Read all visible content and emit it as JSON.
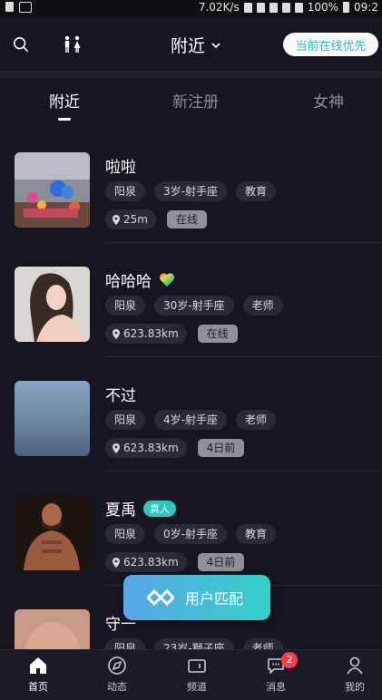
{
  "status_bar": {
    "net_speed": "7.02K/s",
    "battery": "100%",
    "time": "09:2"
  },
  "header": {
    "title": "附近",
    "online_first_label": "当前在线优先"
  },
  "tabs": [
    {
      "label": "附近",
      "active": true
    },
    {
      "label": "新注册",
      "active": false
    },
    {
      "label": "女神",
      "active": false
    }
  ],
  "users": [
    {
      "name": "啦啦",
      "badge": "",
      "tags": [
        "阳泉",
        "3岁-射手座",
        "教育"
      ],
      "distance": "25m",
      "status": "在线"
    },
    {
      "name": "哈哈哈",
      "badge": "",
      "tags": [
        "阳泉",
        "30岁-射手座",
        "老师"
      ],
      "distance": "623.83km",
      "status": "在线"
    },
    {
      "name": "不过",
      "badge": "",
      "tags": [
        "阳泉",
        "4岁-射手座",
        "老师"
      ],
      "distance": "623.83km",
      "status": "4日前"
    },
    {
      "name": "夏禹",
      "badge": "真人",
      "tags": [
        "阳泉",
        "0岁-射手座",
        "教育"
      ],
      "distance": "623.83km",
      "status": "4日前"
    },
    {
      "name": "守一",
      "badge": "",
      "tags": [
        "阳泉",
        "23岁-獅子座",
        "老师"
      ],
      "distance": "",
      "status": ""
    }
  ],
  "match_button": {
    "label": "用户匹配"
  },
  "bottom_nav": [
    {
      "label": "首页",
      "icon": "home-icon",
      "active": true
    },
    {
      "label": "动态",
      "icon": "compass-icon",
      "active": false
    },
    {
      "label": "频道",
      "icon": "video-icon",
      "active": false
    },
    {
      "label": "消息",
      "icon": "message-icon",
      "active": false,
      "badge": "2"
    },
    {
      "label": "我的",
      "icon": "profile-icon",
      "active": false
    }
  ],
  "colors": {
    "background": "#15161f",
    "accent": "#2fc4c0",
    "badge_red": "#ff3b4b"
  }
}
